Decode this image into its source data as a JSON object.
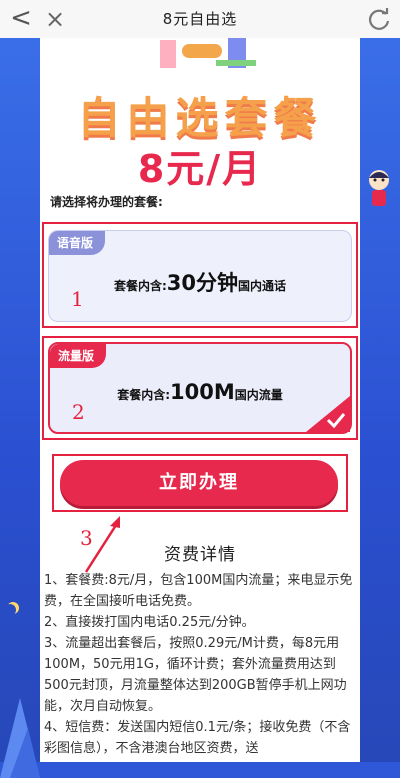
{
  "topbar": {
    "title": "8元自由选",
    "back_icon": "<",
    "close_icon": "×"
  },
  "hero": {
    "title": "自由选套餐",
    "price": "8元/月"
  },
  "prompt": "请选择将办理的套餐:",
  "plans": [
    {
      "tag": "语音版",
      "prefix": "套餐内含:",
      "amount": "30分钟",
      "suffix": "国内通话",
      "annotation": "1",
      "selected": false
    },
    {
      "tag": "流量版",
      "prefix": "套餐内含:",
      "amount": "100M",
      "suffix": "国内流量",
      "annotation": "2",
      "selected": true
    }
  ],
  "button": {
    "label": "立即办理",
    "annotation": "3"
  },
  "fees": {
    "title": "资费详情",
    "items": [
      "1、套餐费:8元/月，包含100M国内流量；来电显示免费，在全国接听电话免费。",
      "2、直接拨打国内电话0.25元/分钟。",
      "3、流量超出套餐后，按照0.29元/M计费，每8元用100M，50元用1G，循环计费；套外流量费用达到500元封顶，月流量整体达到200GB暂停手机上网功能，次月自动恢复。",
      "4、短信费：发送国内短信0.1元/条；接收免费（不含彩图信息），不含港澳台地区资费，送"
    ]
  },
  "colors": {
    "accent": "#e8294e",
    "frame": "#e4213e",
    "side": "#2e58d8"
  }
}
